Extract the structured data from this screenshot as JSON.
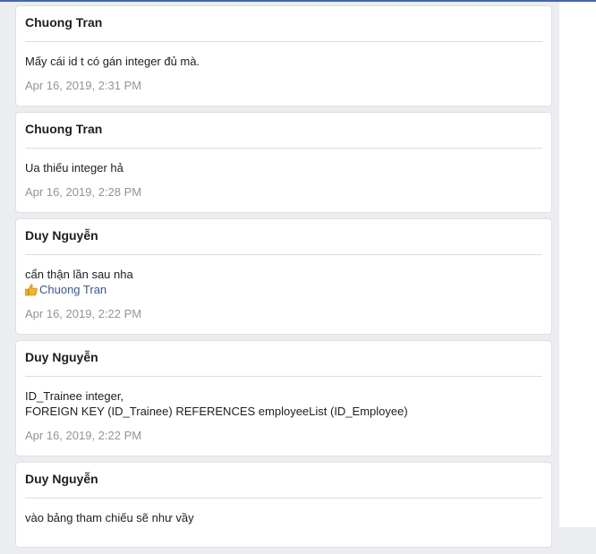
{
  "messages": [
    {
      "author": "Chuong Tran",
      "lines": [
        "Mấy cái id t có gán integer đủ mà."
      ],
      "time": "Apr 16, 2019, 2:31 PM"
    },
    {
      "author": "Chuong Tran",
      "lines": [
        "Ua thiếu integer hả"
      ],
      "time": "Apr 16, 2019, 2:28 PM"
    },
    {
      "author": "Duy Nguyễn",
      "lines": [
        "cẩn thận lần sau nha"
      ],
      "mention": "Chuong Tran",
      "time": "Apr 16, 2019, 2:22 PM"
    },
    {
      "author": "Duy Nguyễn",
      "lines": [
        "ID_Trainee integer,",
        "FOREIGN KEY (ID_Trainee) REFERENCES employeeList (ID_Employee)"
      ],
      "time": "Apr 16, 2019, 2:22 PM"
    },
    {
      "author": "Duy Nguyễn",
      "lines": [
        "vào bảng tham chiếu sẽ như vầy"
      ],
      "time": ""
    }
  ],
  "colors": {
    "background": "#ebedf0",
    "accent": "#4267b2",
    "timestamp": "#90949c"
  }
}
